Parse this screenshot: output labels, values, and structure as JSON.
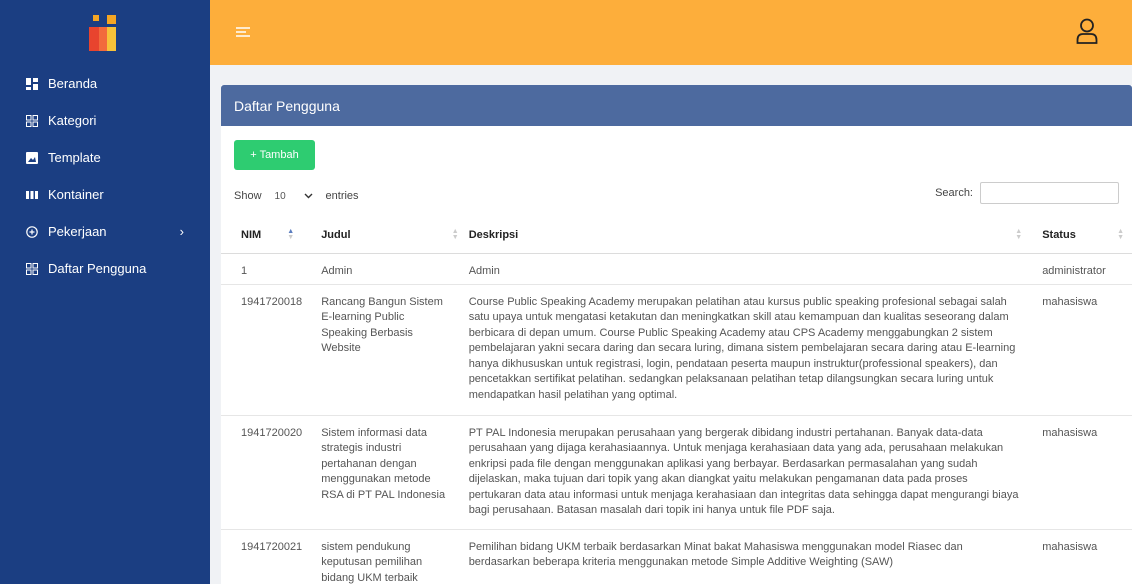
{
  "sidebar": {
    "items": [
      {
        "label": "Beranda",
        "icon": "dashboard-icon"
      },
      {
        "label": "Kategori",
        "icon": "grid-icon"
      },
      {
        "label": "Template",
        "icon": "image-icon"
      },
      {
        "label": "Kontainer",
        "icon": "columns-icon"
      },
      {
        "label": "Pekerjaan",
        "icon": "plus-circle-icon",
        "has_submenu": true
      },
      {
        "label": "Daftar Pengguna",
        "icon": "grid-icon"
      }
    ]
  },
  "colors": {
    "sidebar": "#1b3e82",
    "topbar": "#fdae3b",
    "card_header": "#4d6a9f",
    "add_button": "#2ecc71"
  },
  "card": {
    "title": "Daftar Pengguna",
    "add_button_label": "+ Tambah",
    "show_label": "Show",
    "page_size": "10",
    "entries_label": "entries",
    "search_label": "Search:",
    "search_value": ""
  },
  "table": {
    "headers": [
      "NIM",
      "Judul",
      "Deskripsi",
      "Status"
    ],
    "rows": [
      {
        "nim": "1",
        "judul": "Admin",
        "deskripsi": "Admin",
        "status": "administrator"
      },
      {
        "nim": "1941720018",
        "judul": "Rancang Bangun Sistem E-learning Public Speaking Berbasis Website",
        "deskripsi": "Course Public Speaking Academy merupakan pelatihan atau kursus public speaking profesional sebagai salah satu upaya untuk mengatasi ketakutan dan meningkatkan skill atau kemampuan dan kualitas seseorang dalam berbicara di depan umum. Course Public Speaking Academy atau CPS Academy menggabungkan 2 sistem pembelajaran yakni secara daring dan secara luring, dimana sistem pembelajaran secara daring atau E-learning hanya dikhususkan untuk registrasi, login, pendataan peserta maupun instruktur(professional speakers), dan pencetakkan sertifikat pelatihan. sedangkan pelaksanaan pelatihan tetap dilangsungkan secara luring untuk mendapatkan hasil pelatihan yang optimal.",
        "status": "mahasiswa"
      },
      {
        "nim": "1941720020",
        "judul": "Sistem informasi data strategis industri pertahanan dengan menggunakan metode RSA di PT PAL Indonesia",
        "deskripsi": "PT PAL Indonesia merupakan perusahaan yang bergerak dibidang industri pertahanan. Banyak data-data perusahaan yang dijaga kerahasiaannya. Untuk menjaga kerahasiaan data yang ada, perusahaan melakukan enkripsi pada file dengan menggunakan aplikasi yang berbayar. Berdasarkan permasalahan yang sudah dijelaskan, maka tujuan dari topik yang akan diangkat yaitu melakukan pengamanan data pada proses pertukaran data atau informasi untuk menjaga kerahasiaan dan integritas data sehingga dapat mengurangi biaya bagi perusahaan. Batasan masalah dari topik ini hanya untuk file PDF saja.",
        "status": "mahasiswa"
      },
      {
        "nim": "1941720021",
        "judul": "sistem pendukung keputusan pemilihan bidang UKM terbaik berdasarkan Minat bakat",
        "deskripsi": "Pemilihan bidang UKM terbaik berdasarkan Minat bakat Mahasiswa menggunakan model Riasec dan berdasarkan beberapa kriteria menggunakan metode Simple Additive Weighting (SAW)",
        "status": "mahasiswa"
      }
    ]
  }
}
